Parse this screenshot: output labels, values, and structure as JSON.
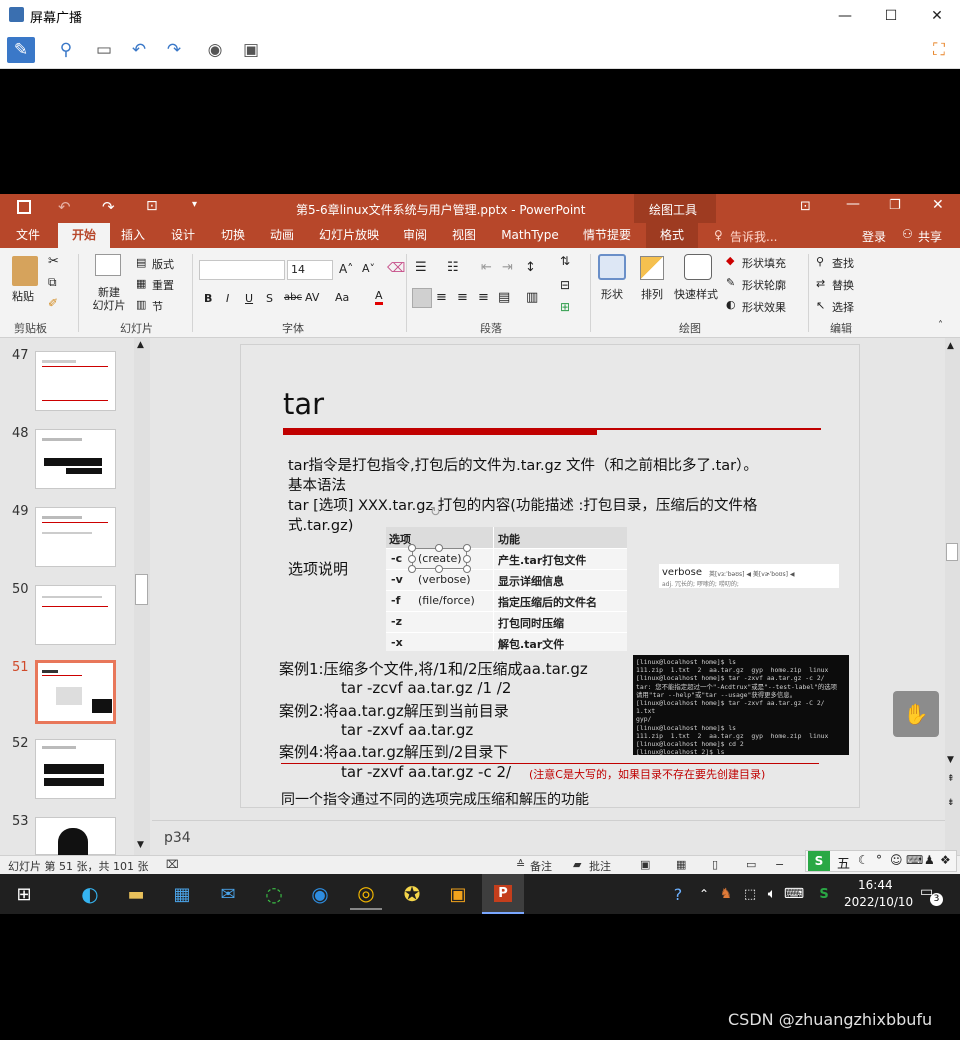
{
  "outer_window": {
    "title": "屏幕广播",
    "min": "—",
    "max": "☐",
    "close": "✕"
  },
  "powerpoint": {
    "file_title": "第5-6章linux文件系统与用户管理.pptx - PowerPoint",
    "context_tab": "绘图工具",
    "tabs": [
      "文件",
      "开始",
      "插入",
      "设计",
      "切换",
      "动画",
      "幻灯片放映",
      "审阅",
      "视图",
      "MathType",
      "情节提要",
      "格式"
    ],
    "tell_me": "告诉我...",
    "login": "登录",
    "share": "共享",
    "ribbon": {
      "paste": "粘贴",
      "new_slide": "新建\n幻灯片",
      "layout": "版式",
      "reset": "重置",
      "section": "节",
      "font_size": "14",
      "shape": "形状",
      "arrange": "排列",
      "quick_style": "快速样式",
      "shape_fill": "形状填充",
      "shape_outline": "形状轮廓",
      "shape_effect": "形状效果",
      "find": "查找",
      "replace": "替换",
      "select": "选择",
      "groups": [
        "剪贴板",
        "幻灯片",
        "字体",
        "段落",
        "绘图",
        "编辑"
      ]
    },
    "thumbs": [
      {
        "num": "47",
        "sel": false
      },
      {
        "num": "48",
        "sel": false
      },
      {
        "num": "49",
        "sel": false
      },
      {
        "num": "50",
        "sel": false
      },
      {
        "num": "51",
        "sel": true
      },
      {
        "num": "52",
        "sel": false
      },
      {
        "num": "53",
        "sel": false
      }
    ],
    "notes_text": "p34",
    "status": {
      "slide_info": "幻灯片 第 51 张，共 101 张",
      "notes": "备注",
      "comments": "批注"
    }
  },
  "slide": {
    "title": "tar",
    "line1": "tar指令是打包指令,打包后的文件为.tar.gz 文件（和之前相比多了.tar）。",
    "line2": "基本语法",
    "line3": "tar [选项] XXX.tar.gz 打包的内容(功能描述 :打包目录，压缩后的文件格",
    "line4": "式.tar.gz)",
    "options_label": "选项说明",
    "table_head": [
      "选项",
      "功能"
    ],
    "table_rows": [
      [
        "-c",
        "(create)",
        "产生.tar打包文件"
      ],
      [
        "-v",
        "(verbose)",
        "显示详细信息"
      ],
      [
        "-f",
        "(file/force)",
        "指定压缩后的文件名"
      ],
      [
        "-z",
        "",
        "打包同时压缩"
      ],
      [
        "-x",
        "",
        "解包.tar文件"
      ]
    ],
    "verbose_word": "verbose",
    "verbose_phon": "英[vɜːˈbəʊs]  ◀  美[vɚˈboʊs]  ◀",
    "verbose_def": "adj.  冗长的; 啰嗦的; 唠叨的;",
    "case1": "案例1:压缩多个文件,将/1和/2压缩成aa.tar.gz",
    "case1_cmd": "tar -zcvf aa.tar.gz /1 /2",
    "case2": "案例2:将aa.tar.gz解压到当前目录",
    "case2_cmd": "tar -zxvf  aa.tar.gz",
    "case4": "案例4:将aa.tar.gz解压到/2目录下",
    "case4_cmd": "tar -zxvf  aa.tar.gz -c 2/",
    "case4_note": "(注意C是大写的，如果目录不存在要先创建目录)",
    "footer_line": "同一个指令通过不同的选项完成压缩和解压的功能",
    "terminal": "[linux@localhost home]$ ls\n111.zip  1.txt  2  aa.tar.gz  gyp  home.zip  linux\n[linux@localhost home]$ tar -zxvf aa.tar.gz -c 2/\ntar: 您不能指定超过一个\"-Acdtrux\"或是\"--test-label\"的选项\n请用\"tar --help\"或\"tar --usage\"获得更多信息。\n[linux@localhost home]$ tar -zxvf aa.tar.gz -C 2/\n1.txt\ngyp/\n[linux@localhost home]$ ls\n111.zip  1.txt  2  aa.tar.gz  gyp  home.zip  linux\n[linux@localhost home]$ cd 2\n[linux@localhost 2]$ ls\n1.txt  gyp"
  },
  "ime": {
    "label": "五"
  },
  "taskbar": {
    "time": "16:44",
    "date": "2022/10/10",
    "notif": "3"
  },
  "watermark": "CSDN @zhuangzhixbbufu",
  "colors": {
    "ppt_red": "#b7472a",
    "title_bar_red": "#c00000"
  }
}
